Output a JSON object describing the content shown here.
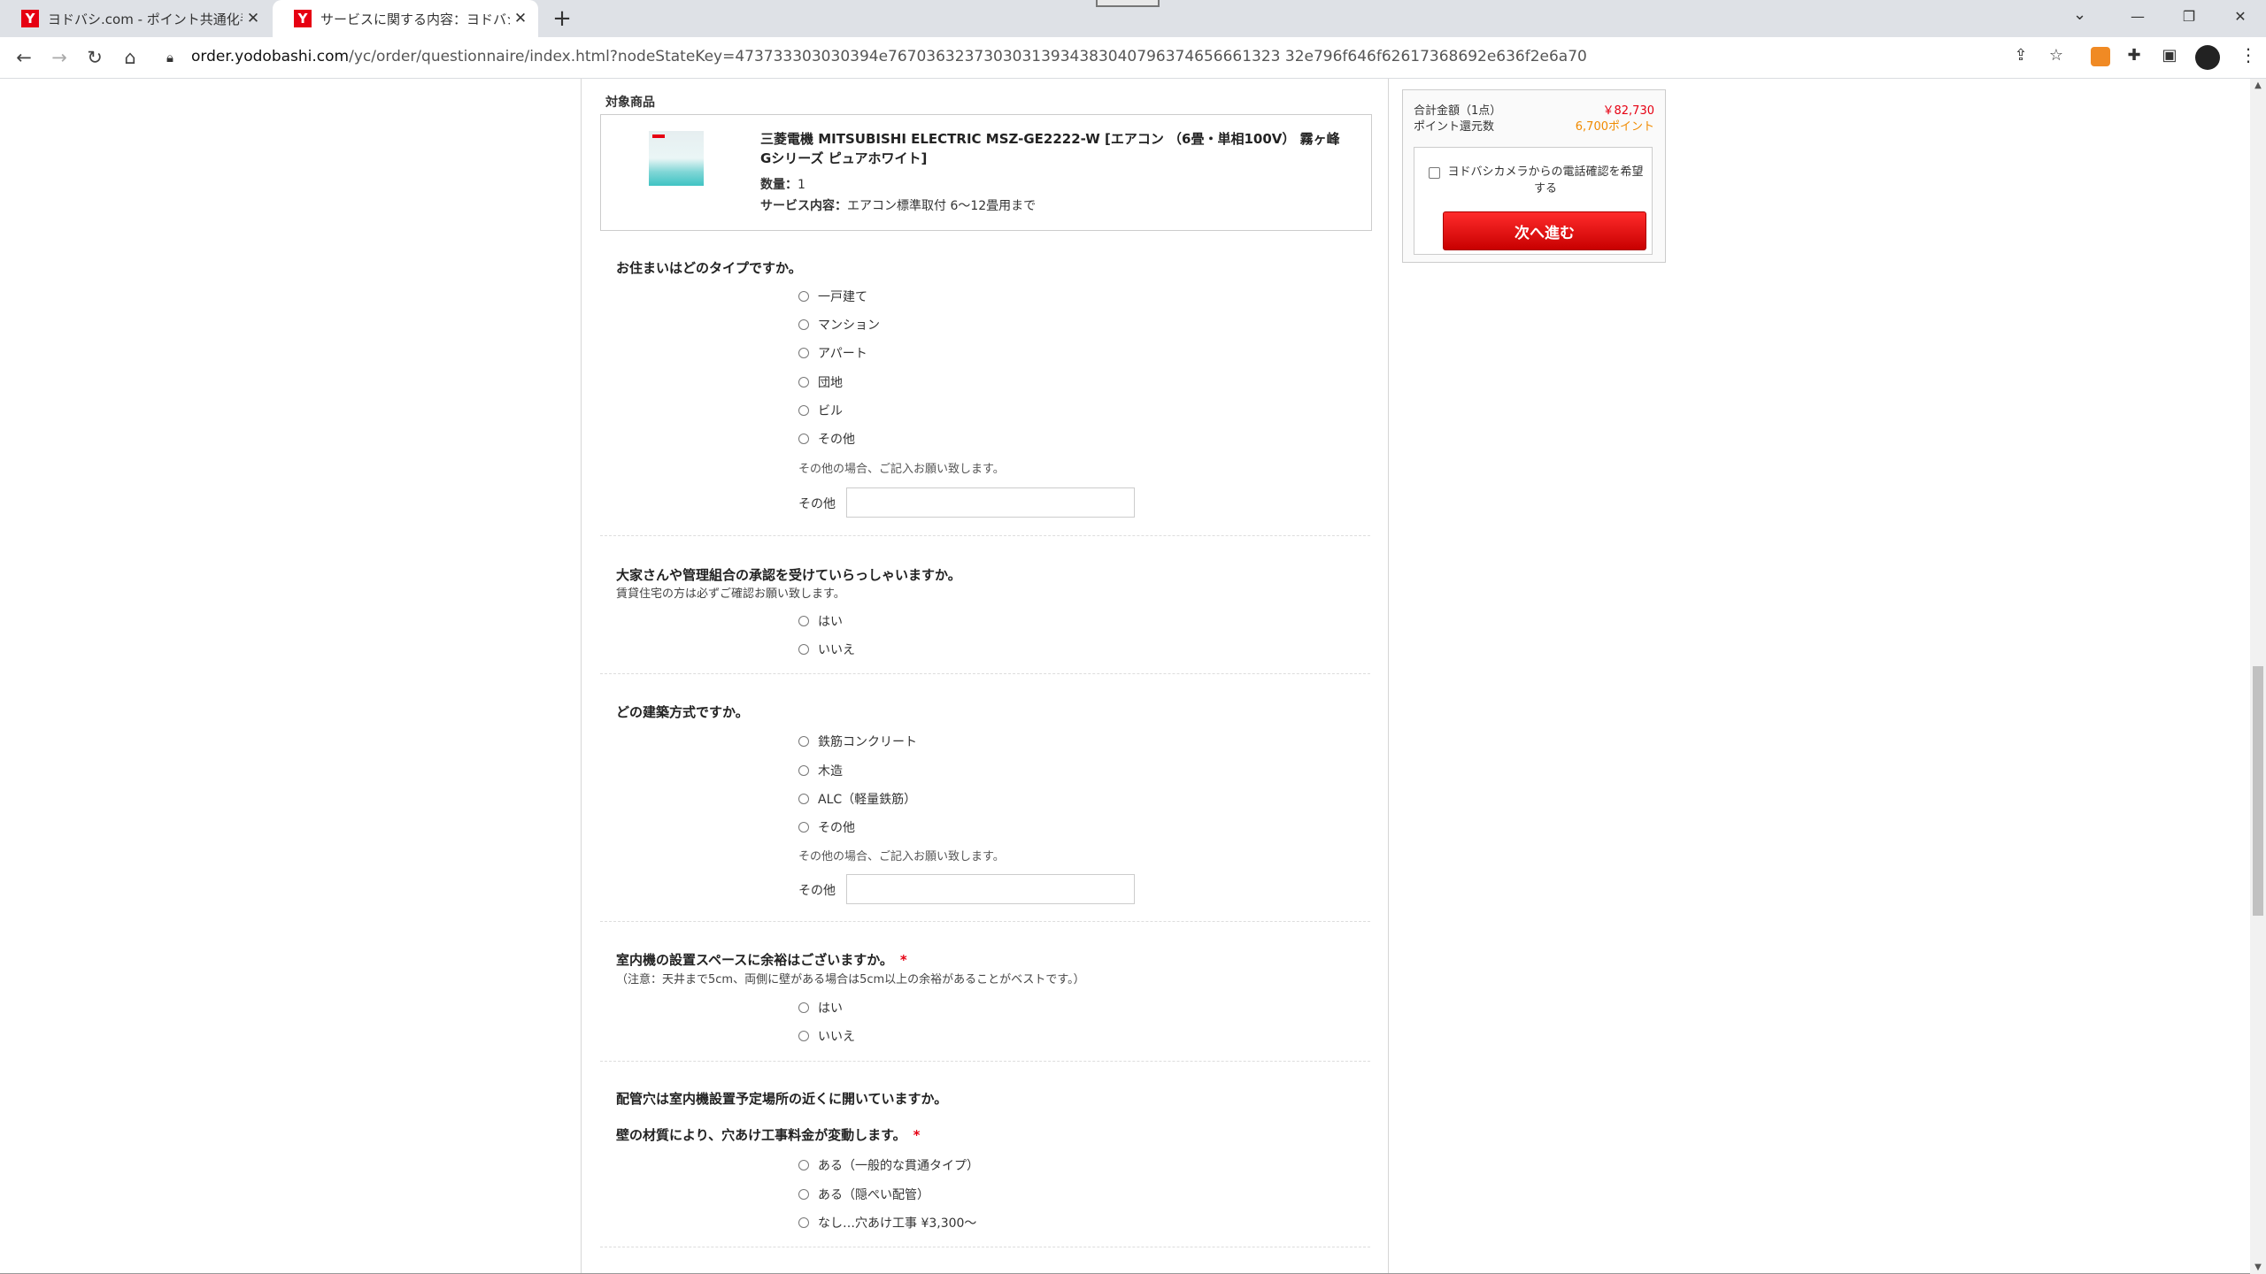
{
  "browser": {
    "tabs": [
      {
        "title": "ヨドバシ.com - ポイント共通化手続き"
      },
      {
        "title": "サービスに関する内容：ヨドバシ・ドット"
      }
    ],
    "favicon": "Y",
    "url_domain": "order.yodobashi.com",
    "url_path": "/yc/order/questionnaire/index.html?nodeStateKey=473733303030394e76703632373030313934383040796374656661323 32e796f646f62617368692e636f2e6a70"
  },
  "product": {
    "section_label": "対象商品",
    "name": "三菱電機 MITSUBISHI ELECTRIC MSZ-GE2222-W [エアコン （6畳・単相100V） 霧ヶ峰 Gシリーズ ピュアホワイト]",
    "qty_label": "数量：",
    "qty_value": "1",
    "service_label": "サービス内容：",
    "service_value": "エアコン標準取付 6〜12畳用まで"
  },
  "questions": {
    "q1": {
      "title": "お住まいはどのタイプですか。",
      "options": [
        "一戸建て",
        "マンション",
        "アパート",
        "団地",
        "ビル",
        "その他"
      ],
      "hint": "その他の場合、ご記入お願い致します。",
      "other_label": "その他"
    },
    "q2": {
      "title": "大家さんや管理組合の承認を受けていらっしゃいますか。",
      "note": "賃貸住宅の方は必ずご確認お願い致します。",
      "options": [
        "はい",
        "いいえ"
      ]
    },
    "q3": {
      "title": "どの建築方式ですか。",
      "options": [
        "鉄筋コンクリート",
        "木造",
        "ALC（軽量鉄筋）",
        "その他"
      ],
      "hint": "その他の場合、ご記入お願い致します。",
      "other_label": "その他"
    },
    "q4": {
      "title": "室内機の設置スペースに余裕はございますか。",
      "required": "*",
      "note": "（注意：天井まで5cm、両側に壁がある場合は5cm以上の余裕があることがベストです。）",
      "options": [
        "はい",
        "いいえ"
      ]
    },
    "q5": {
      "title": "配管穴は室内機設置予定場所の近くに開いていますか。",
      "subtitle": "壁の材質により、穴あけ工事料金が変動します。",
      "required": "*",
      "options": [
        "ある（一般的な貫通タイプ）",
        "ある（隠ぺい配管）",
        "なし…穴あけ工事 ¥3,300〜"
      ]
    }
  },
  "summary": {
    "total_label": "合計金額（1点）",
    "total_value": "￥82,730",
    "points_label": "ポイント還元数",
    "points_value": "6,700ポイント",
    "phone_confirm": "ヨドバシカメラからの電話確認を希望する",
    "next_button": "次へ進む"
  }
}
